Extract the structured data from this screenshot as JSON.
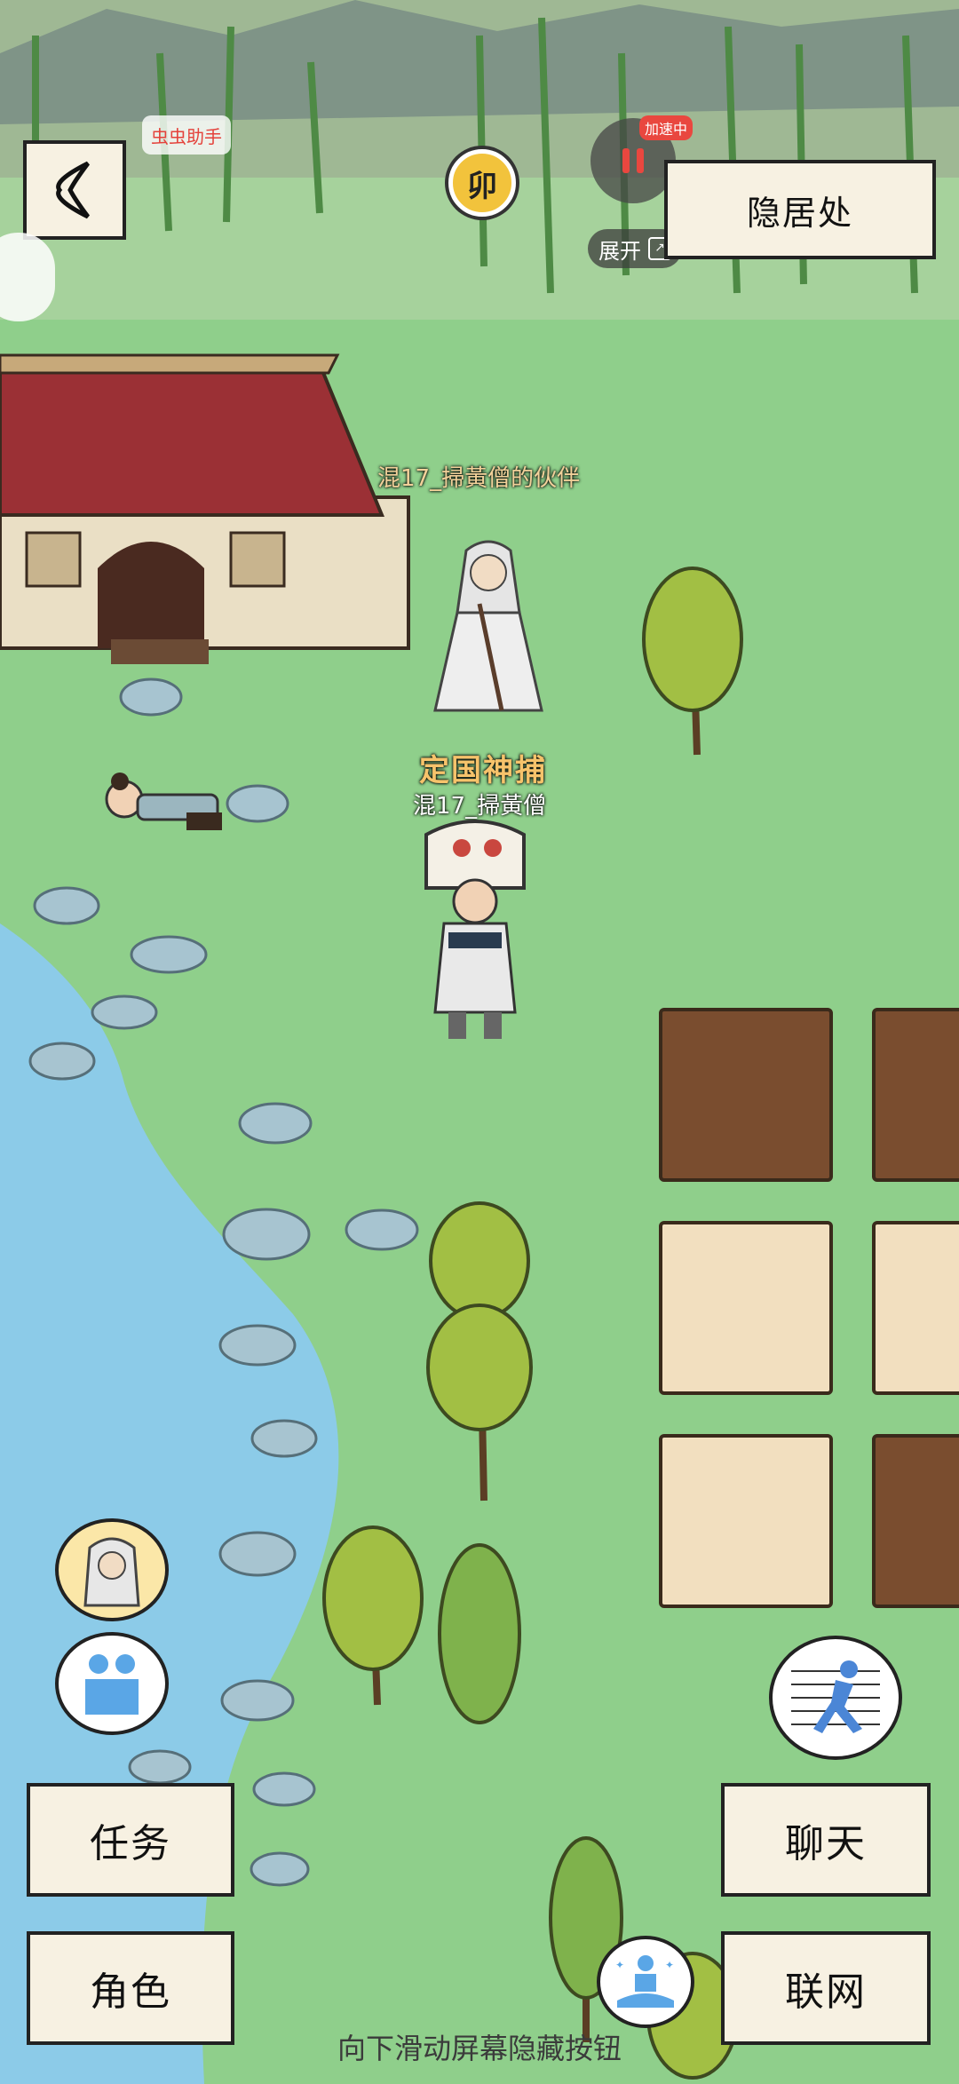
{
  "top_bar": {
    "helper_label": "虫虫助手",
    "time_emblem": "卯",
    "speed_badge": "加速中",
    "expand_label": "展开",
    "location": "隐居处"
  },
  "characters": {
    "companion_name": "混17_掃黃僧的伙伴",
    "player_title": "定国神捕",
    "player_name": "混17_掃黃僧"
  },
  "buttons": {
    "quest": "任务",
    "character": "角色",
    "chat": "聊天",
    "network": "联网"
  },
  "hint": "向下滑动屏幕隐藏按钮",
  "icons": {
    "back": "back-arrow-icon",
    "pause": "pause-icon",
    "expand": "expand-icon",
    "companion_avatar": "companion-avatar-icon",
    "party": "party-icon",
    "run": "run-icon",
    "meditate": "meditate-icon"
  },
  "colors": {
    "grass": "#8fcf8b",
    "water": "#8ccbe8",
    "panel": "#f7f1e2",
    "roof": "#9b3035",
    "title_orange": "#e27a2c"
  }
}
